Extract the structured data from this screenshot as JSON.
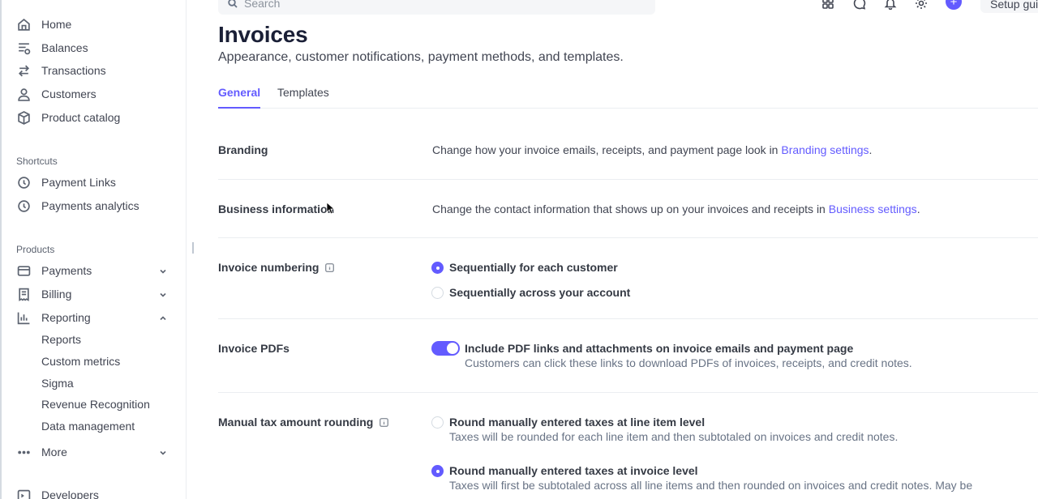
{
  "sidebar": {
    "main_items": [
      {
        "label": "Home",
        "icon": "home-icon"
      },
      {
        "label": "Balances",
        "icon": "balances-icon"
      },
      {
        "label": "Transactions",
        "icon": "transactions-icon"
      },
      {
        "label": "Customers",
        "icon": "customers-icon"
      },
      {
        "label": "Product catalog",
        "icon": "product-catalog-icon"
      }
    ],
    "shortcuts_label": "Shortcuts",
    "shortcuts": [
      {
        "label": "Payment Links",
        "icon": "clock-icon"
      },
      {
        "label": "Payments analytics",
        "icon": "clock-icon"
      }
    ],
    "products_label": "Products",
    "products": [
      {
        "label": "Payments",
        "icon": "payments-icon",
        "expanded": false
      },
      {
        "label": "Billing",
        "icon": "billing-icon",
        "expanded": false
      },
      {
        "label": "Reporting",
        "icon": "reporting-icon",
        "expanded": true
      }
    ],
    "reporting_sub": [
      "Reports",
      "Custom metrics",
      "Sigma",
      "Revenue Recognition",
      "Data management"
    ],
    "more_label": "More",
    "developers_label": "Developers"
  },
  "topbar": {
    "search_placeholder": "Search",
    "setup_label": "Setup gui"
  },
  "page": {
    "title": "Invoices",
    "subtitle": "Appearance, customer notifications, payment methods, and templates.",
    "tabs": [
      {
        "label": "General",
        "active": true
      },
      {
        "label": "Templates",
        "active": false
      }
    ]
  },
  "settings": {
    "branding": {
      "label": "Branding",
      "text": "Change how your invoice emails, receipts, and payment page look in ",
      "link": "Branding settings",
      "suffix": "."
    },
    "business": {
      "label": "Business information",
      "text": "Change the contact information that shows up on your invoices and receipts in ",
      "link": "Business settings",
      "suffix": "."
    },
    "numbering": {
      "label": "Invoice numbering",
      "options": [
        {
          "label": "Sequentially for each customer",
          "selected": true
        },
        {
          "label": "Sequentially across your account",
          "selected": false
        }
      ]
    },
    "pdfs": {
      "label": "Invoice PDFs",
      "toggle_on": true,
      "toggle_label": "Include PDF links and attachments on invoice emails and payment page",
      "toggle_desc": "Customers can click these links to download PDFs of invoices, receipts, and credit notes."
    },
    "rounding": {
      "label": "Manual tax amount rounding",
      "options": [
        {
          "label": "Round manually entered taxes at line item level",
          "desc": "Taxes will be rounded for each line item and then subtotaled on invoices and credit notes.",
          "selected": false
        },
        {
          "label": "Round manually entered taxes at invoice level",
          "desc": "Taxes will first be subtotaled across all line items and then rounded on invoices and credit notes. May be",
          "selected": true
        }
      ]
    }
  },
  "colors": {
    "accent": "#635bff",
    "text": "#353a44",
    "muted": "#687385",
    "divider": "#ebeef1"
  }
}
